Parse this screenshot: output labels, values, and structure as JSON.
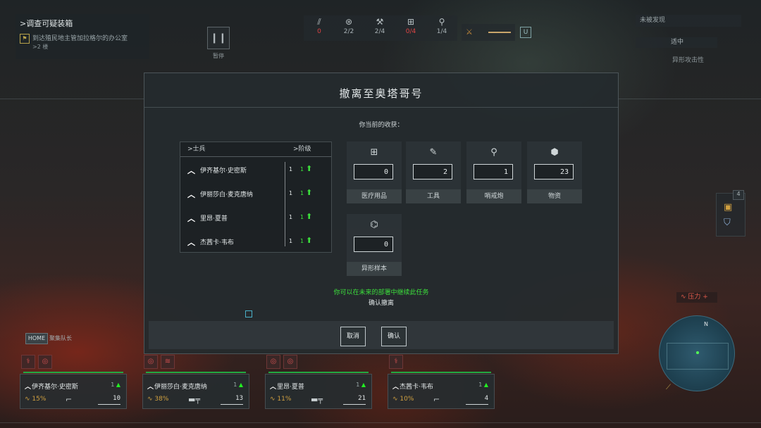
{
  "objective": {
    "title": ">调查可疑装箱",
    "detail": "到达殖民地主管加拉格尔的办公室",
    "sub": ">2 楼"
  },
  "pause_label": "暂停",
  "top_resources": [
    {
      "icon": "ammo-icon",
      "glyph": "⫽",
      "value": "0",
      "alert": true
    },
    {
      "icon": "badge-icon",
      "glyph": "⊛",
      "value": "2/2",
      "alert": false
    },
    {
      "icon": "tools-icon",
      "glyph": "⚒",
      "value": "2/4",
      "alert": false
    },
    {
      "icon": "medkit-icon",
      "glyph": "⊞",
      "value": "0/4",
      "alert": true
    },
    {
      "icon": "turret-icon",
      "glyph": "⚲",
      "value": "1/4",
      "alert": false
    }
  ],
  "top_right": {
    "status": "未被发现",
    "mid": "适中",
    "label": "异形攻击性"
  },
  "side_count": "4",
  "pressure_label": "压力 +",
  "minimap_north": "N",
  "home": {
    "key": "HOME",
    "label": "聚集队长"
  },
  "squad": [
    {
      "name": "伊齐基尔·史密斯",
      "rank": "1",
      "stress": "15%",
      "ammo": "10"
    },
    {
      "name": "伊丽莎白·麦克唐纳",
      "rank": "1",
      "stress": "38%",
      "ammo": "13"
    },
    {
      "name": "里昂·夏普",
      "rank": "1",
      "stress": "11%",
      "ammo": "21"
    },
    {
      "name": "杰茜卡·韦布",
      "rank": "1",
      "stress": "10%",
      "ammo": "4"
    }
  ],
  "dialog": {
    "title": "撤离至奥塔哥号",
    "subtitle": "你当前的收获：",
    "roster_header": {
      "soldier": ">士兵",
      "rank": ">阶级"
    },
    "roster": [
      {
        "name": "伊齐基尔·史密斯",
        "rank": "1",
        "rank_new": "1"
      },
      {
        "name": "伊丽莎白·麦克唐纳",
        "rank": "1",
        "rank_new": "1"
      },
      {
        "name": "里昂·夏普",
        "rank": "1",
        "rank_new": "1"
      },
      {
        "name": "杰茜卡·韦布",
        "rank": "1",
        "rank_new": "1"
      }
    ],
    "resources": [
      {
        "icon": "medkit-icon",
        "glyph": "⊞",
        "value": "0",
        "label": "医疗用品"
      },
      {
        "icon": "wrench-icon",
        "glyph": "✎",
        "value": "2",
        "label": "工具"
      },
      {
        "icon": "sentry-turret-icon",
        "glyph": "⚲",
        "value": "1",
        "label": "哨戒炮"
      },
      {
        "icon": "supplies-cube-icon",
        "glyph": "⬢",
        "value": "23",
        "label": "物资"
      },
      {
        "icon": "dna-icon",
        "glyph": "⌬",
        "value": "0",
        "label": "异形样本"
      }
    ],
    "note": "你可以在未来的部署中继续此任务",
    "confirm_prompt": "确认撤离",
    "cancel_label": "取消",
    "confirm_label": "确认"
  },
  "colors": {
    "accent_green": "#3ce03c",
    "alert_red": "#dd4444",
    "stress_amber": "#d0a040"
  }
}
